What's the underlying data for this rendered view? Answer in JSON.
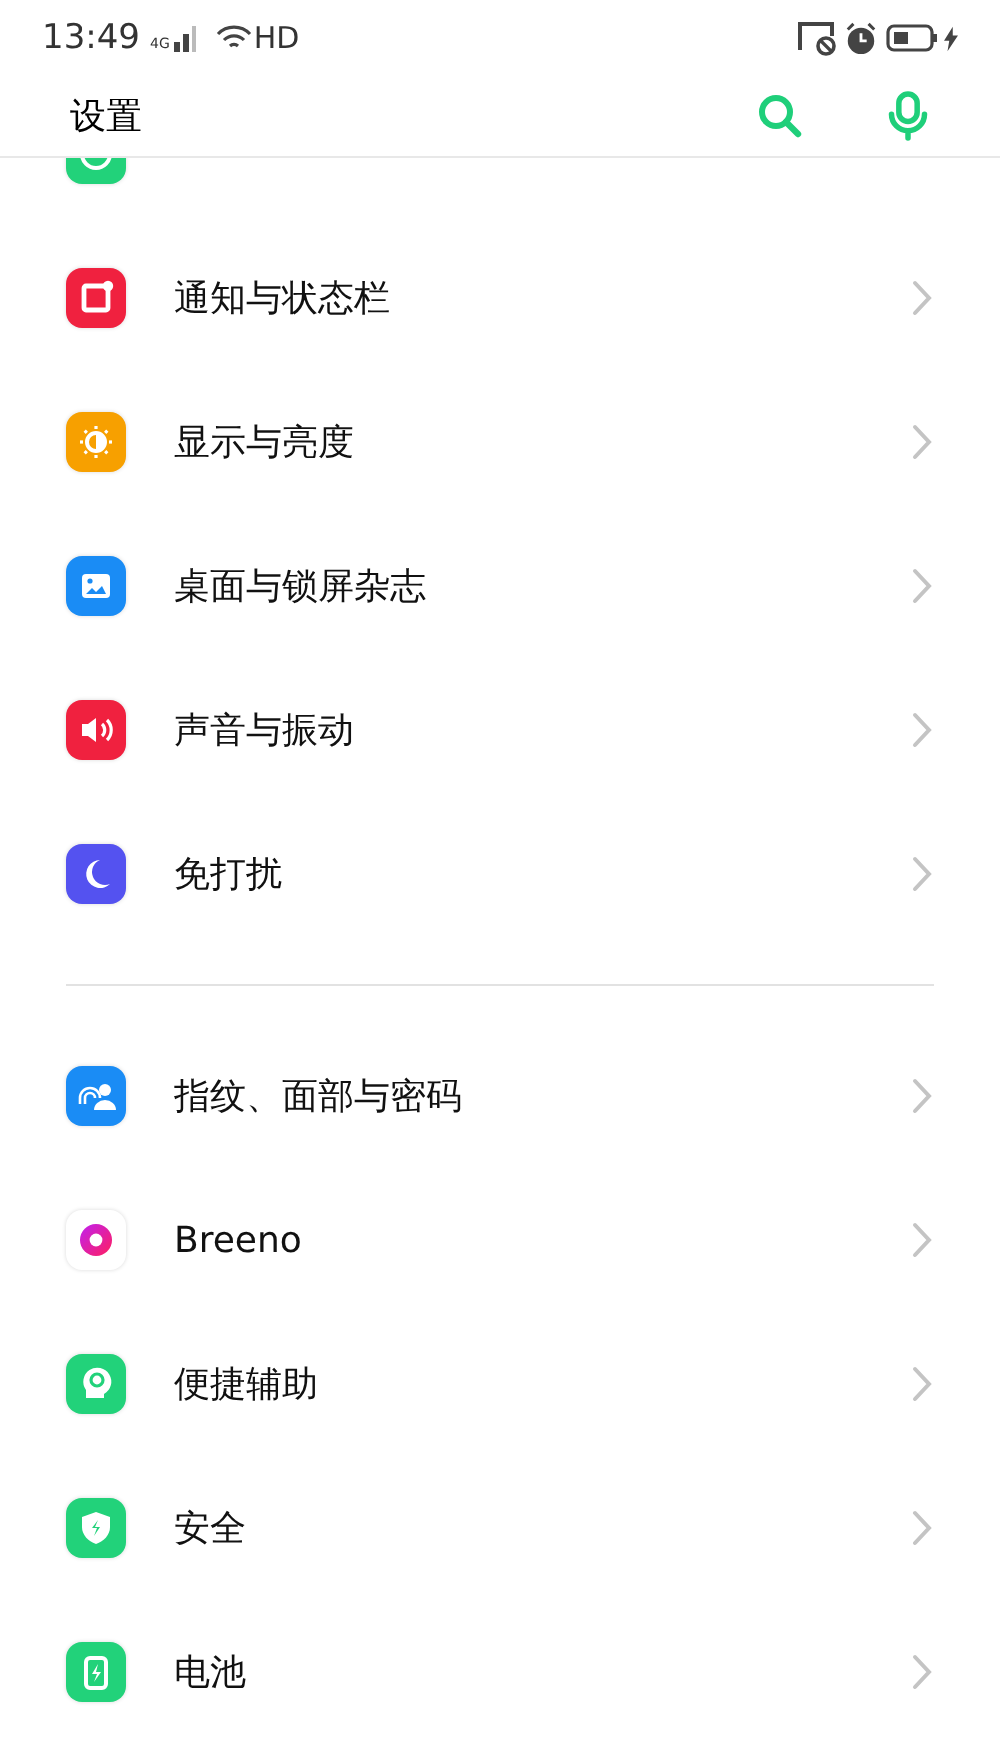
{
  "status_bar": {
    "time": "13:49",
    "network": "4G",
    "wifi_label": "HD"
  },
  "header": {
    "title": "设置"
  },
  "partial_row": {
    "kind": "green-app",
    "color": "#22d27a"
  },
  "groups": [
    {
      "items": [
        {
          "label": "通知与状态栏",
          "kind": "notification",
          "color": "#f0213f"
        },
        {
          "label": "显示与亮度",
          "kind": "brightness",
          "color": "#f7a000"
        },
        {
          "label": "桌面与锁屏杂志",
          "kind": "wallpaper",
          "color": "#1a8cf5"
        },
        {
          "label": "声音与振动",
          "kind": "sound",
          "color": "#f0213f"
        },
        {
          "label": "免打扰",
          "kind": "moon",
          "color": "#5452f0"
        }
      ]
    },
    {
      "items": [
        {
          "label": "指纹、面部与密码",
          "kind": "fingerprint",
          "color": "#1a8cf5"
        },
        {
          "label": "Breeno",
          "kind": "breeno",
          "color": "#ffffff"
        },
        {
          "label": "便捷辅助",
          "kind": "assist",
          "color": "#22d27a"
        },
        {
          "label": "安全",
          "kind": "shield",
          "color": "#22d27a"
        },
        {
          "label": "电池",
          "kind": "battery",
          "color": "#22d27a"
        }
      ]
    }
  ]
}
